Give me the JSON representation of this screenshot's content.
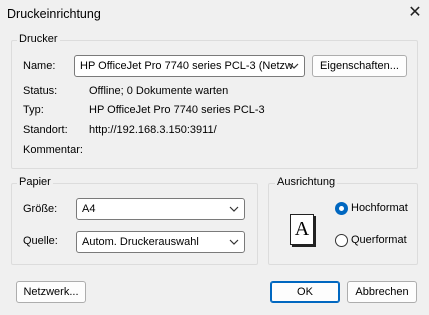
{
  "window": {
    "title": "Druckeinrichtung",
    "close_symbol": "✕"
  },
  "printer_group": {
    "title": "Drucker",
    "name_label": "Name:",
    "name_value": "HP OfficeJet Pro 7740 series PCL-3 (Netzw",
    "properties_button": "Eigenschaften...",
    "status_label": "Status:",
    "status_value": "Offline; 0 Dokumente warten",
    "type_label": "Typ:",
    "type_value": "HP OfficeJet Pro 7740 series PCL-3",
    "location_label": "Standort:",
    "location_value": "http://192.168.3.150:3911/",
    "comment_label": "Kommentar:",
    "comment_value": ""
  },
  "paper_group": {
    "title": "Papier",
    "size_label": "Größe:",
    "size_value": "A4",
    "source_label": "Quelle:",
    "source_value": "Autom. Druckerauswahl"
  },
  "orientation_group": {
    "title": "Ausrichtung",
    "preview_glyph": "A",
    "portrait_label": "Hochformat",
    "landscape_label": "Querformat",
    "selected": "Hochformat"
  },
  "buttons": {
    "network": "Netzwerk...",
    "ok": "OK",
    "cancel": "Abbrechen"
  },
  "colors": {
    "accent": "#0067c0",
    "background": "#f0f0f0"
  }
}
